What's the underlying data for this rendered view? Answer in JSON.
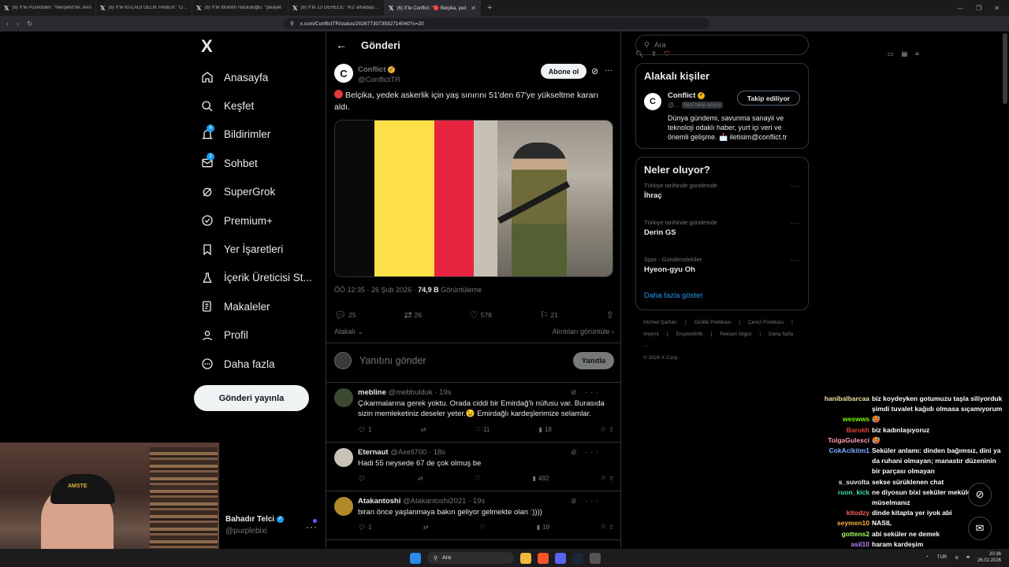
{
  "browser": {
    "tabs": [
      {
        "title": "(6) X'te Pusholden: \"Nevşehir'de, evin"
      },
      {
        "title": "(6) X'te KULAĞI DELİK HABER: \"Ordu"
      },
      {
        "title": "(6) X'te İbrahim Haskoloğlu: \"Şikayet"
      },
      {
        "title": "(6) X'te Z3 DERECE: \"Kız arkadaşına o"
      },
      {
        "title": "(6) X'te Conflict: \"🔴 Belçika, yed"
      }
    ],
    "url": "x.com/ConflictTR/status/2026773073932714040?s=20"
  },
  "nav": {
    "logo": "X",
    "items": [
      {
        "label": "Anasayfa",
        "icon": "home-icon",
        "badge": ""
      },
      {
        "label": "Keşfet",
        "icon": "search-icon",
        "badge": ""
      },
      {
        "label": "Bildirimler",
        "icon": "bell-icon",
        "badge": "4"
      },
      {
        "label": "Sohbet",
        "icon": "mail-icon",
        "badge": "2"
      },
      {
        "label": "SuperGrok",
        "icon": "grok-icon",
        "badge": ""
      },
      {
        "label": "Premium+",
        "icon": "verified-icon",
        "badge": ""
      },
      {
        "label": "Yer İşaretleri",
        "icon": "bookmark-icon",
        "badge": ""
      },
      {
        "label": "İçerik Üreticisi St...",
        "icon": "flask-icon",
        "badge": ""
      },
      {
        "label": "Makaleler",
        "icon": "article-icon",
        "badge": ""
      },
      {
        "label": "Profil",
        "icon": "person-icon",
        "badge": ""
      },
      {
        "label": "Daha fazla",
        "icon": "more-circle-icon",
        "badge": ""
      }
    ],
    "post_button": "Gönderi yayınla",
    "user": {
      "name": "Bahadır Telci",
      "handle": "@purplebixi"
    }
  },
  "webcam": {
    "cap_text": "AMSTE"
  },
  "main": {
    "header_title": "Gönderi",
    "tweet": {
      "author_name": "Conflict",
      "author_handle": "@ConflictTR",
      "subscribe_label": "Abone ol",
      "text": "Belçika, yedek askerlik için yaş sınırını 51'den 67'ye yükseltme kararı aldı.",
      "time": "ÖÖ 12:35 · 26 Şub 2026 · ",
      "views": "74,9 B",
      "views_label": " Görüntüleme",
      "replies": "25",
      "reposts": "26",
      "likes": "578",
      "bookmarks": "21",
      "relevance_label": "Alakalı",
      "quotes_label": "Alıntıları görüntüle"
    },
    "reply_placeholder": "Yanıtını gönder",
    "reply_button": "Yanıtla",
    "replies": [
      {
        "name": "mebline",
        "handle": "@mebbulduk",
        "time": "· 19s",
        "text": "Çıkarmalarına gerek yoktu. Orada ciddi bir Emirdağ'lı nüfusu var. Burasıda sizin memleketiniz deseler yeter.😉 Emirdağlı kardeşlerimize selamlar.",
        "replies": "1",
        "reposts": "",
        "likes": "11",
        "views": "18"
      },
      {
        "name": "Eternaut",
        "handle": "@Axell700",
        "time": "· 18s",
        "text": "Hadi 55 neysede 67 de çok olmuş be",
        "replies": "",
        "reposts": "",
        "likes": "",
        "views": "492"
      },
      {
        "name": "Atakantoshi",
        "handle": "@Atakantoshi2021",
        "time": "· 19s",
        "text": "biran önce yaşlanmaya bakın geliyor gelmekte olan :))))",
        "replies": "1",
        "reposts": "",
        "likes": "",
        "views": "18"
      }
    ]
  },
  "sidebar": {
    "search_placeholder": "Ara",
    "related_title": "Alakalı kişiler",
    "related": {
      "name": "Conflict",
      "handle": "@...",
      "follows_you": "Seni takip ediyor",
      "follow_button": "Takip ediliyor",
      "bio": "Dünya gündemi, savunma sanayii ve teknoloji odaklı haber, yurt içi veri ve önemli gelişme. 📩 iletisim@conflict.tr"
    },
    "trends_title": "Neler oluyor?",
    "trends": [
      {
        "context": "Türkiye tarihinde gündemde",
        "topic": "İhraç"
      },
      {
        "context": "Türkiye tarihinde gündemde",
        "topic": "Derin GS"
      },
      {
        "context": "Spor · Gündemdekiler",
        "topic": "Hyeon-gyu Oh"
      }
    ],
    "show_more": "Daha fazla göster",
    "footer": [
      "Hizmet Şartları",
      "|",
      "Gizlilik Politikası",
      "|",
      "Çerez Politikası",
      "|",
      "Imprint",
      "|",
      "Erişilebilirlik",
      "|",
      "Reklam bilgisi",
      "|",
      "Daha fazla ···",
      "© 2026 X Corp."
    ]
  },
  "chat": [
    {
      "user": "hanibalbarcaa",
      "color": "#f0e0a0",
      "text": "biz koydeyken gotumuzu taşla siliyorduk şimdi tuvalet kağıdı olmasa sıçamıyorum"
    },
    {
      "user": "weswws",
      "color": "#7cfc00",
      "text": "🥵"
    },
    {
      "user": "Barokh",
      "color": "#e0443a",
      "text": "biz kadınlaşıyoruz"
    },
    {
      "user": "TolgaGulesci",
      "color": "#ff9fb0",
      "text": "🥵"
    },
    {
      "user": "CokAciktim1",
      "color": "#7fb0ff",
      "text": "Seküler anlamı: dinden bağımsız, dini ya da ruhani olmayan; manastır düzeninin bir parçası olmayan"
    },
    {
      "user": "s_suvolta",
      "color": "#e7e9ea",
      "text": "sekse sürüklenen chat"
    },
    {
      "user": "ruon_kick",
      "color": "#40e0a0",
      "text": "ne diyosun bixi seküler meküler. Biz müselmanız"
    },
    {
      "user": "kitodzy",
      "color": "#ff6060",
      "text": "dinde kitapta yer iyok abi"
    },
    {
      "user": "seymen10",
      "color": "#ffb040",
      "text": "NASIL"
    },
    {
      "user": "gottens2",
      "color": "#a0ff60",
      "text": "abi seküler ne demek"
    },
    {
      "user": "asil10",
      "color": "#c080ff",
      "text": "haram kardeşim"
    }
  ],
  "taskbar": {
    "search": "Ara",
    "lang": "TUR",
    "time": "20:36",
    "date": "26.02.2026"
  }
}
